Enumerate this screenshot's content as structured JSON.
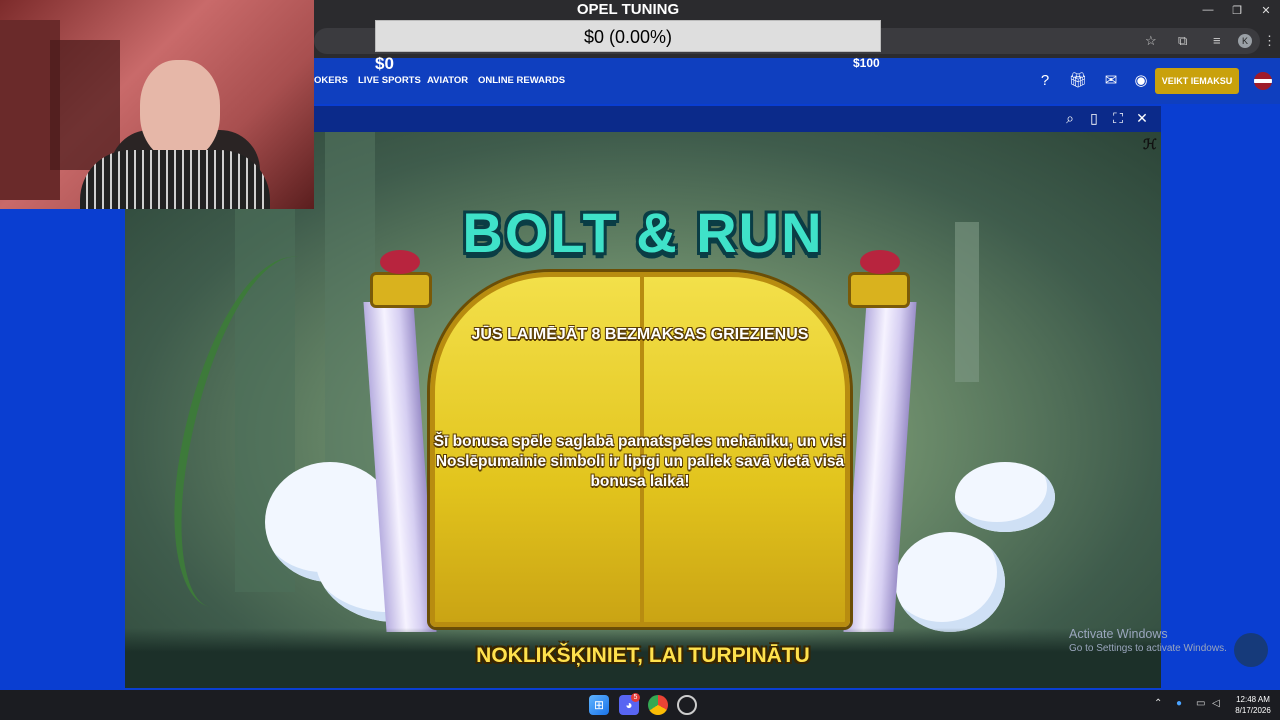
{
  "stream_overlay": {
    "title": "OPEL TUNING",
    "progress_label": "$0 (0.00%)",
    "progress_fraction": 0.0,
    "start_value": "$0",
    "end_value": "$100"
  },
  "site_nav": {
    "items": [
      "OKERS",
      "LIVE SPORTS",
      "AVIATOR",
      "ONLINE REWARDS"
    ],
    "deposit_label": "VEIKT IEMAKSU"
  },
  "game": {
    "title": "BOLT & RUN",
    "win_line": "JŪS LAIMĒJĀT 8 BEZMAKSAS GRIEZIENUS",
    "description": "Šī bonusa spēle saglabā pamatspēles mehāniku, un visi Noslēpumainie simboli ir lipīgi un paliek savā vietā visā bonusa laikā!",
    "cta": "NOKLIKŠĶINIET, LAI TURPINĀTU"
  },
  "windows_watermark": {
    "line1": "Activate Windows",
    "line2": "Go to Settings to activate Windows."
  },
  "taskbar": {
    "time": "12:48 AM",
    "date": "8/17/2026",
    "discord_badge": "5"
  },
  "browser": {
    "profile_initial": "K"
  },
  "colors": {
    "site_blue": "#0f3fbf",
    "deposit_gold": "#c9a10c",
    "title_teal": "#3fe2c9",
    "cta_yellow": "#ffe14d"
  }
}
